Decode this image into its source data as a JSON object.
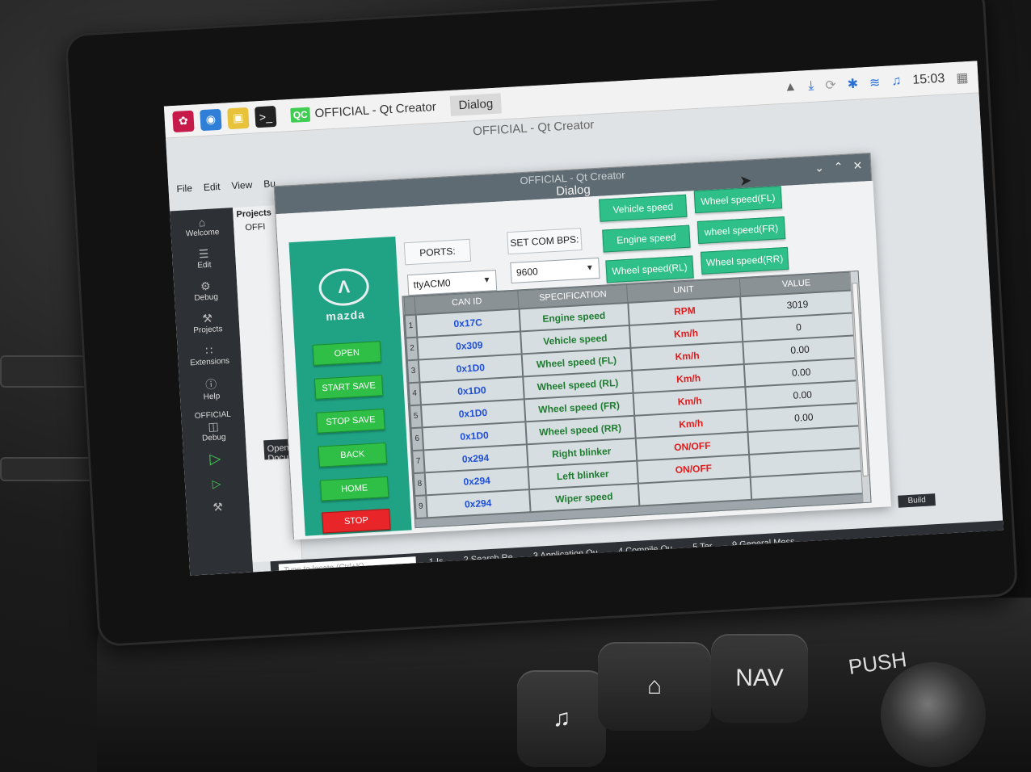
{
  "taskbar": {
    "tasks": [
      {
        "badge": "QC",
        "label": "OFFICIAL - Qt Creator"
      },
      {
        "badge": "",
        "label": "Dialog"
      }
    ],
    "clock": "15:03"
  },
  "qtcreator": {
    "window_title": "OFFICIAL - Qt Creator",
    "menu": [
      "File",
      "Edit",
      "View",
      "Bu"
    ],
    "projects_label": "Projects",
    "project_name": "OFFI",
    "sidebar": [
      "Welcome",
      "Edit",
      "Debug",
      "Projects",
      "Extensions",
      "Help"
    ],
    "kit_label": "OFFICIAL",
    "kit_mode": "Debug",
    "open_docs": "Open Docu",
    "locator_placeholder": "Type to locate (Ctrl+K)",
    "output_tabs": [
      "1  Is...",
      "2  Search Re...",
      "3  Application Ou...",
      "4  Compile Ou...",
      "5  Ter...",
      "9  General Mess..."
    ],
    "build_label": "Build"
  },
  "dialog": {
    "window_title": "OFFICIAL - Qt Creator",
    "title": "Dialog",
    "logo_text": "mazda",
    "side_buttons": [
      "OPEN",
      "START SAVE",
      "STOP SAVE",
      "BACK",
      "HOME",
      "STOP"
    ],
    "ports_label": "PORTS:",
    "ports_value": "ttyACM0",
    "bps_label": "SET COM BPS:",
    "bps_value": "9600",
    "signal_buttons": [
      "Vehicle speed",
      "Wheel speed(FL)",
      "Engine speed",
      "wheel speed(FR)",
      "Wheel speed(RL)",
      "Wheel speed(RR)"
    ],
    "table": {
      "headers": [
        "CAN ID",
        "SPECIFICATION",
        "UNIT",
        "VALUE"
      ],
      "rows": [
        {
          "n": "1",
          "can_id": "0x17C",
          "spec": "Engine speed",
          "unit": "RPM",
          "value": "3019"
        },
        {
          "n": "2",
          "can_id": "0x309",
          "spec": "Vehicle speed",
          "unit": "Km/h",
          "value": "0"
        },
        {
          "n": "3",
          "can_id": "0x1D0",
          "spec": "Wheel speed (FL)",
          "unit": "Km/h",
          "value": "0.00"
        },
        {
          "n": "4",
          "can_id": "0x1D0",
          "spec": "Wheel speed (RL)",
          "unit": "Km/h",
          "value": "0.00"
        },
        {
          "n": "5",
          "can_id": "0x1D0",
          "spec": "Wheel speed (FR)",
          "unit": "Km/h",
          "value": "0.00"
        },
        {
          "n": "6",
          "can_id": "0x1D0",
          "spec": "Wheel speed (RR)",
          "unit": "Km/h",
          "value": "0.00"
        },
        {
          "n": "7",
          "can_id": "0x294",
          "spec": "Right blinker",
          "unit": "ON/OFF",
          "value": ""
        },
        {
          "n": "8",
          "can_id": "0x294",
          "spec": "Left blinker",
          "unit": "ON/OFF",
          "value": ""
        },
        {
          "n": "9",
          "can_id": "0x294",
          "spec": "Wiper speed",
          "unit": "",
          "value": ""
        }
      ]
    }
  },
  "car_console": {
    "buttons": [
      "NAV"
    ],
    "push_label": "PUSH"
  },
  "colors": {
    "panel_green": "#1fa384",
    "button_green": "#2fbf46",
    "stop_red": "#e8262a",
    "can_id_blue": "#1f4fd6",
    "spec_green": "#1d7c2e",
    "unit_red": "#e01b1b"
  }
}
